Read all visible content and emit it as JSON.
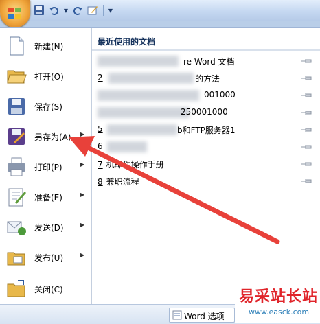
{
  "quick_access": {
    "items": [
      "save-icon",
      "undo-icon",
      "redo-icon",
      "edit-icon"
    ]
  },
  "menu": {
    "items": [
      {
        "label": "新建(N)",
        "icon": "new-document-icon",
        "arrow": ""
      },
      {
        "label": "打开(O)",
        "icon": "open-folder-icon",
        "arrow": ""
      },
      {
        "label": "保存(S)",
        "icon": "save-disk-icon",
        "arrow": ""
      },
      {
        "label": "另存为(A)",
        "icon": "save-as-icon",
        "arrow": "▶"
      },
      {
        "label": "打印(P)",
        "icon": "printer-icon",
        "arrow": "▶"
      },
      {
        "label": "准备(E)",
        "icon": "prepare-icon",
        "arrow": "▶"
      },
      {
        "label": "发送(D)",
        "icon": "send-icon",
        "arrow": "▶"
      },
      {
        "label": "发布(U)",
        "icon": "publish-icon",
        "arrow": "▶"
      },
      {
        "label": "关闭(C)",
        "icon": "close-folder-icon",
        "arrow": ""
      }
    ]
  },
  "recent": {
    "title": "最近使用的文档",
    "items": [
      {
        "num": "",
        "text": "re Word 文档"
      },
      {
        "num": "2",
        "text": "的方法"
      },
      {
        "num": "",
        "text": "001000"
      },
      {
        "num": "",
        "text": "250001000"
      },
      {
        "num": "5",
        "text": "b和FTP服务器1"
      },
      {
        "num": "6",
        "text": ""
      },
      {
        "num": "7",
        "text": "机邮件操作手册"
      },
      {
        "num": "8",
        "text": "兼职流程"
      }
    ]
  },
  "bottom": {
    "word_options_label": "Word 选项"
  },
  "watermark": {
    "title": "易采站长站",
    "url": "www.easck.com"
  },
  "colors": {
    "arrow": "#e8413a",
    "office_button": "#f0a53b"
  }
}
